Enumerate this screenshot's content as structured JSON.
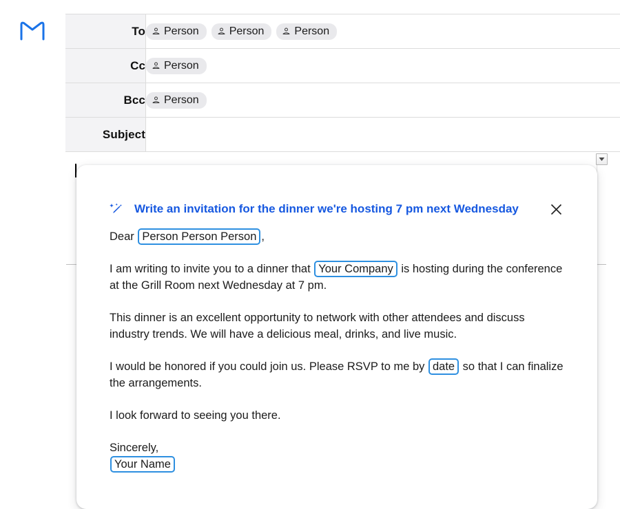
{
  "app": {
    "logo_icon": "gmail-m-icon"
  },
  "compose": {
    "rows": [
      {
        "label": "To",
        "chips": [
          {
            "icon": "person-icon",
            "label": "Person"
          },
          {
            "icon": "person-icon",
            "label": "Person"
          },
          {
            "icon": "person-icon",
            "label": "Person"
          }
        ]
      },
      {
        "label": "Cc",
        "chips": [
          {
            "icon": "person-icon",
            "label": "Person"
          }
        ]
      },
      {
        "label": "Bcc",
        "chips": [
          {
            "icon": "person-icon",
            "label": "Person"
          }
        ]
      },
      {
        "label": "Subject",
        "chips": []
      }
    ]
  },
  "scrollbar": {
    "down_arrow_icon": "chevron-down-icon"
  },
  "suggestion_card": {
    "header": {
      "icon": "magic-pen-icon",
      "title": "Write an invitation for the dinner we're hosting 7 pm next Wednesday",
      "close_icon": "close-icon"
    },
    "body": {
      "salutation_prefix": "Dear ",
      "salutation_placeholder": "Person Person Person",
      "salutation_suffix": ",",
      "p1_before": "I am writing to invite you to a dinner that ",
      "p1_placeholder": "Your Company",
      "p1_after": " is hosting during the conference at the Grill Room next Wednesday at 7 pm.",
      "p2": "This dinner is an excellent opportunity to network with other attendees and discuss industry trends. We will have a delicious meal, drinks, and live music.",
      "p3_before": "I would be honored if you could join us. Please RSVP to me by ",
      "p3_placeholder": "date",
      "p3_after": " so that I can finalize the arrangements.",
      "p4": "I look forward to seeing you there.",
      "closing": "Sincerely,",
      "signature_placeholder": "Your Name"
    }
  },
  "colors": {
    "accent_blue": "#1658e0",
    "placeholder_border": "#2d8fe0",
    "chip_background": "#e9e9ec",
    "label_background": "#f3f3f5"
  }
}
